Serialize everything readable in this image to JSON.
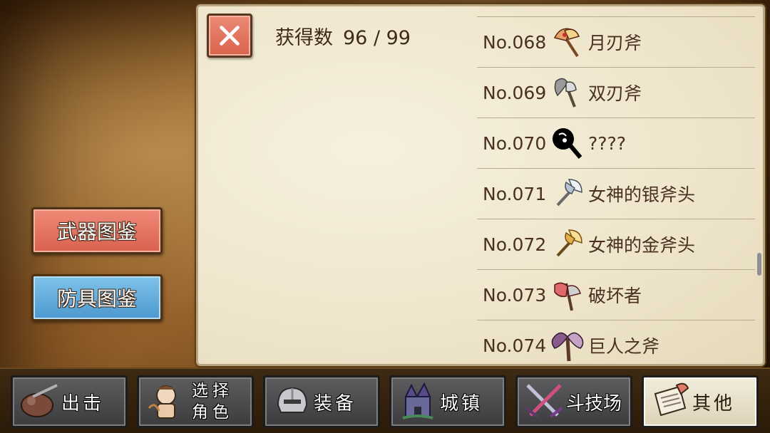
{
  "panel": {
    "close_icon": "close-icon",
    "obtained_label": "获得数",
    "obtained_value": "96 / 99"
  },
  "list": [
    {
      "no": "No.068",
      "name": "月刃斧",
      "icon": "moon-blade-axe-icon",
      "colors": [
        "#e8a06a",
        "#c9302c",
        "#f3d48a"
      ]
    },
    {
      "no": "No.069",
      "name": "双刃斧",
      "icon": "double-blade-axe-icon",
      "colors": [
        "#9a9a9a",
        "#6b6b6b",
        "#dcdcdc"
      ]
    },
    {
      "no": "No.070",
      "name": "????",
      "icon": "unknown-axe-silhouette-icon",
      "colors": [
        "#000000",
        "#000000",
        "#000000"
      ]
    },
    {
      "no": "No.071",
      "name": "女神的银斧头",
      "icon": "silver-axe-icon",
      "colors": [
        "#b8c4cf",
        "#7e8a96",
        "#eef2f5"
      ]
    },
    {
      "no": "No.072",
      "name": "女神的金斧头",
      "icon": "golden-axe-icon",
      "colors": [
        "#e0b04a",
        "#a8701c",
        "#f7e094"
      ]
    },
    {
      "no": "No.073",
      "name": "破坏者",
      "icon": "destroyer-axe-icon",
      "colors": [
        "#e06a6a",
        "#9a2a2a",
        "#d0d0d0"
      ]
    },
    {
      "no": "No.074",
      "name": "巨人之斧",
      "icon": "giant-axe-icon",
      "colors": [
        "#8a5a8a",
        "#5a3a5a",
        "#c7a2c7"
      ]
    }
  ],
  "side_buttons": {
    "weapons": "武器图鉴",
    "armor": "防具图鉴"
  },
  "nav": [
    {
      "label": "出击",
      "icon": "sortie-icon",
      "active": false
    },
    {
      "label": "选择角色",
      "line1": "选择",
      "line2": "角色",
      "icon": "character-select-icon",
      "active": false
    },
    {
      "label": "装备",
      "icon": "equipment-helmet-icon",
      "active": false
    },
    {
      "label": "城镇",
      "icon": "town-castle-icon",
      "active": false
    },
    {
      "label": "斗技场",
      "icon": "arena-swords-icon",
      "active": false
    },
    {
      "label": "其他",
      "icon": "other-scroll-icon",
      "active": true
    }
  ]
}
